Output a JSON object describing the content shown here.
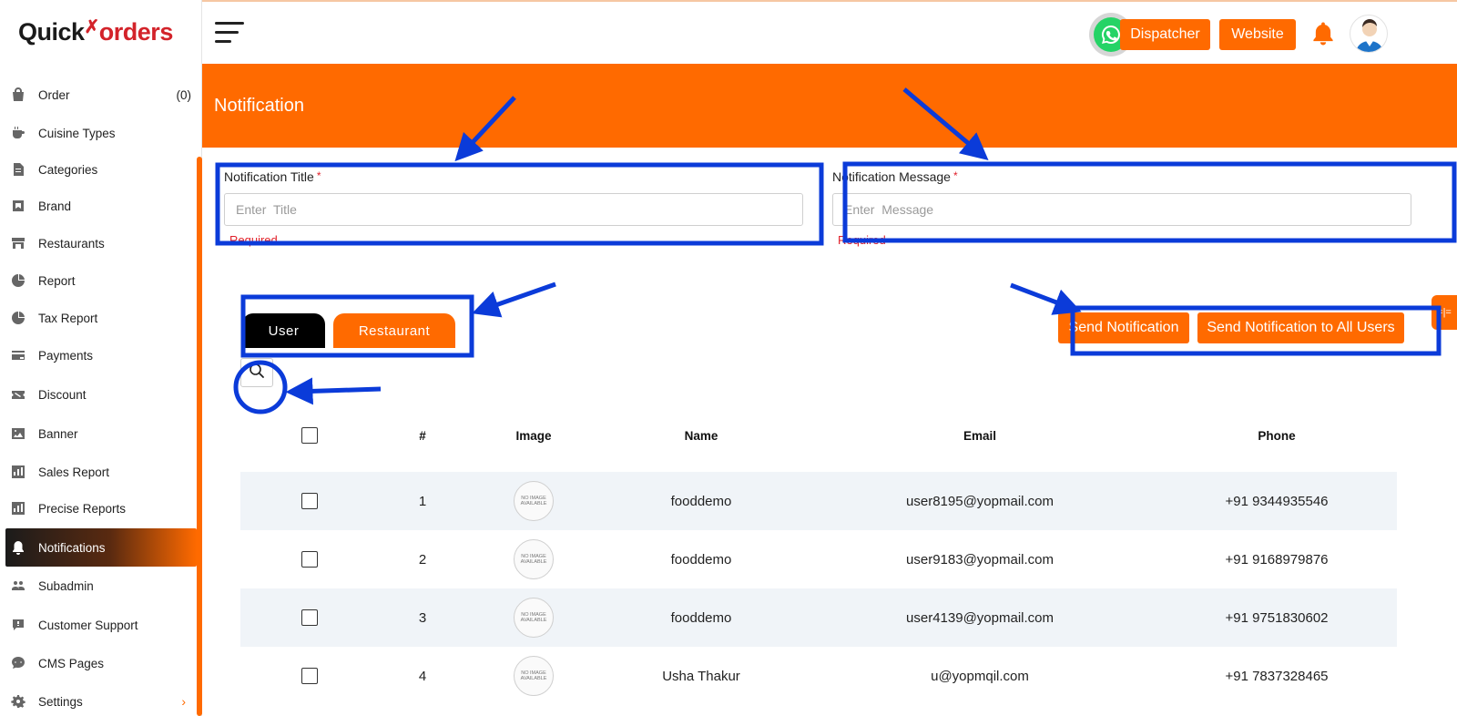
{
  "app": {
    "brand_first": "Quick",
    "brand_second": "orders"
  },
  "colors": {
    "accent": "#ff6a00",
    "annotation": "#0b3bd9",
    "whatsapp": "#25d366"
  },
  "sidebar": {
    "items": [
      {
        "label": "Order",
        "icon": "bag-icon",
        "count": "(0)"
      },
      {
        "label": "Cuisine Types",
        "icon": "cup-icon"
      },
      {
        "label": "Categories",
        "icon": "document-icon"
      },
      {
        "label": "Brand",
        "icon": "tag-icon"
      },
      {
        "label": "Restaurants",
        "icon": "store-icon"
      },
      {
        "label": "Report",
        "icon": "chart-circle-icon"
      },
      {
        "label": "Tax Report",
        "icon": "chart-circle-icon"
      },
      {
        "label": "Payments",
        "icon": "card-icon"
      },
      {
        "label": "Discount",
        "icon": "ticket-icon"
      },
      {
        "label": "Banner",
        "icon": "image-icon"
      },
      {
        "label": "Sales Report",
        "icon": "bar-chart-icon"
      },
      {
        "label": "Precise Reports",
        "icon": "bar-chart-icon"
      },
      {
        "label": "Notifications",
        "icon": "bell-icon",
        "active": true
      },
      {
        "label": "Subadmin",
        "icon": "users-icon"
      },
      {
        "label": "Customer Support",
        "icon": "support-icon"
      },
      {
        "label": "CMS Pages",
        "icon": "chat-icon"
      },
      {
        "label": "Settings",
        "icon": "gear-icon"
      }
    ]
  },
  "header": {
    "dispatcher_label": "Dispatcher",
    "website_label": "Website"
  },
  "page": {
    "title": "Notification"
  },
  "form": {
    "title_label": "Notification Title",
    "title_placeholder": "Enter  Title",
    "message_label": "Notification Message",
    "message_placeholder": "Enter  Message",
    "required_mark": "*",
    "required_text": "Required"
  },
  "tabs": {
    "user": "User",
    "restaurant": "Restaurant"
  },
  "actions": {
    "send": "Send Notification",
    "send_all": "Send Notification to All Users",
    "side_toggle": "=|="
  },
  "table": {
    "headers": {
      "number": "#",
      "image": "Image",
      "name": "Name",
      "email": "Email",
      "phone": "Phone"
    },
    "no_image_text": "NO IMAGE AVAILABLE",
    "rows": [
      {
        "num": "1",
        "name": "fooddemo",
        "email": "user8195@yopmail.com",
        "phone": "+91 9344935546"
      },
      {
        "num": "2",
        "name": "fooddemo",
        "email": "user9183@yopmail.com",
        "phone": "+91 9168979876"
      },
      {
        "num": "3",
        "name": "fooddemo",
        "email": "user4139@yopmail.com",
        "phone": "+91 9751830602"
      },
      {
        "num": "4",
        "name": "Usha Thakur",
        "email": "u@yopmqil.com",
        "phone": "+91 7837328465"
      }
    ]
  }
}
